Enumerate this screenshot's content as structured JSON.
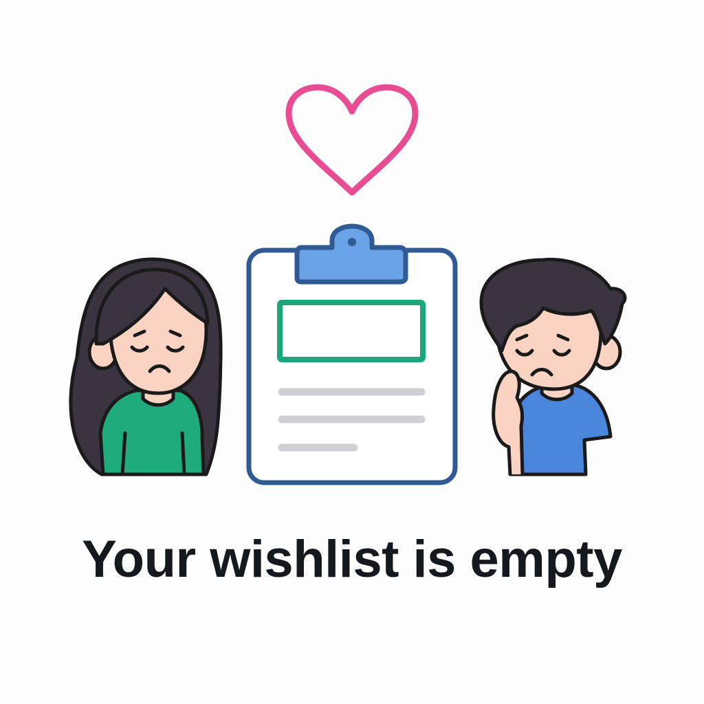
{
  "empty_state": {
    "title": "Your wishlist is empty",
    "icons": {
      "heart": "heart-outline-icon",
      "clipboard": "clipboard-icon",
      "girl": "sad-girl-illustration",
      "boy": "sad-boy-illustration"
    },
    "colors": {
      "heart": "#e84c93",
      "clipboard_outline": "#2f5a93",
      "clipboard_clip": "#69a3e6",
      "highlight_box": "#1aa77a",
      "text_lines": "#cfd0d2",
      "outline": "#1a1a1a",
      "skin": "#fbd3c2",
      "hair": "#3a3340",
      "girl_shirt": "#1fab7c",
      "boy_shirt": "#4a86dc",
      "title_text": "#15181c"
    }
  }
}
